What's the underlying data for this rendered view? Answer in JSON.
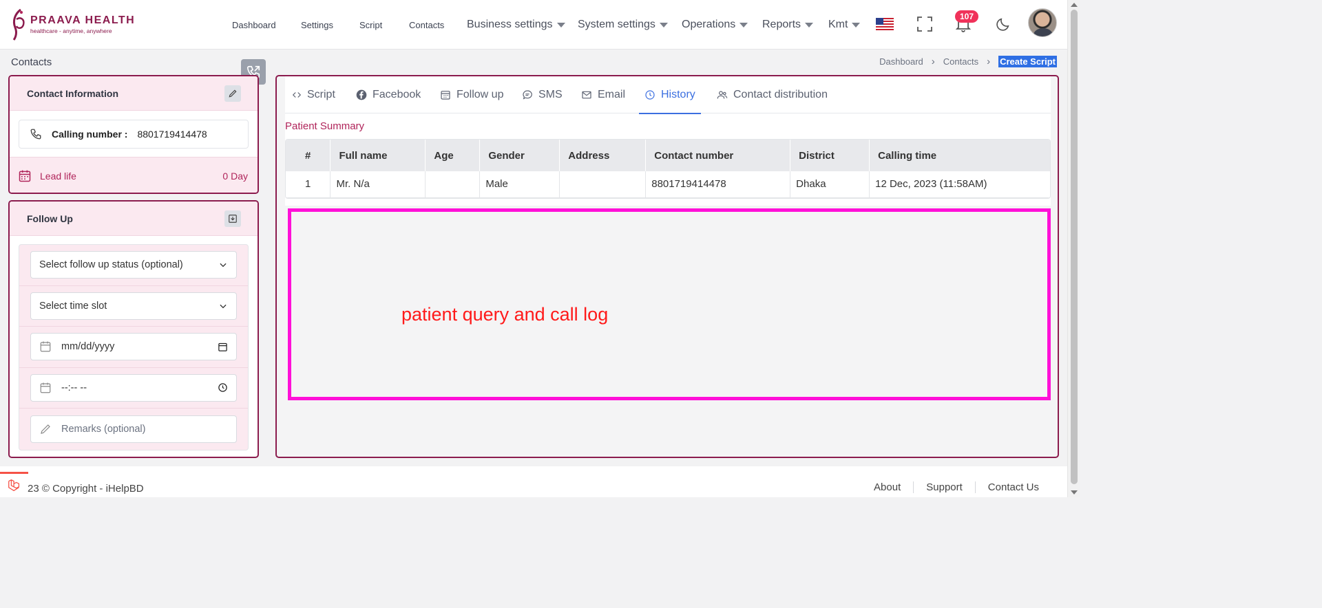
{
  "brand": {
    "name": "PRAAVA HEALTH",
    "tagline": "healthcare - anytime, anywhere",
    "color": "#8b1b4d"
  },
  "nav": {
    "items": [
      {
        "label": "Dashboard",
        "dropdown": false
      },
      {
        "label": "Settings",
        "dropdown": false
      },
      {
        "label": "Script",
        "dropdown": false
      },
      {
        "label": "Contacts",
        "dropdown": false
      },
      {
        "label": "Business settings",
        "dropdown": true
      },
      {
        "label": "System settings",
        "dropdown": true
      },
      {
        "label": "Operations",
        "dropdown": true
      },
      {
        "label": "Reports",
        "dropdown": true
      },
      {
        "label": "Kmt",
        "dropdown": true
      }
    ],
    "notification_count": "107",
    "icons": [
      "us-flag-icon",
      "fullscreen-icon",
      "bell-icon",
      "moon-icon"
    ]
  },
  "page": {
    "title": "Contacts",
    "breadcrumb": [
      "Dashboard",
      "Contacts",
      "Create Script"
    ]
  },
  "contact_info": {
    "title": "Contact Information",
    "calling_label": "Calling number :",
    "calling_number": "8801719414478",
    "lead_life_label": "Lead life",
    "lead_life_value": "0 Day"
  },
  "follow_up": {
    "title": "Follow Up",
    "status_select": "Select follow up status (optional)",
    "time_slot_select": "Select time slot",
    "date_placeholder": "mm/dd/yyyy",
    "time_placeholder": "--:-- --",
    "remarks_placeholder": "Remarks (optional)"
  },
  "tabs": [
    {
      "label": "Script",
      "icon": "code-icon"
    },
    {
      "label": "Facebook",
      "icon": "facebook-icon"
    },
    {
      "label": "Follow up",
      "icon": "calendar-icon"
    },
    {
      "label": "SMS",
      "icon": "chat-icon"
    },
    {
      "label": "Email",
      "icon": "envelope-icon"
    },
    {
      "label": "History",
      "icon": "clock-icon",
      "active": true
    },
    {
      "label": "Contact distribution",
      "icon": "users-icon"
    }
  ],
  "summary": {
    "title": "Patient Summary",
    "columns": [
      "#",
      "Full name",
      "Age",
      "Gender",
      "Address",
      "Contact number",
      "District",
      "Calling time"
    ],
    "rows": [
      [
        "1",
        "Mr. N/a",
        "",
        "Male",
        "",
        "8801719414478",
        "Dhaka",
        "12 Dec, 2023 (11:58AM)"
      ]
    ]
  },
  "annotation": {
    "text": "patient query and call log",
    "border_color": "#ff10d8",
    "text_color": "#ff1a1a"
  },
  "footer": {
    "copyright": "23 © Copyright - iHelpBD",
    "links": [
      "About",
      "Support",
      "Contact Us"
    ]
  }
}
